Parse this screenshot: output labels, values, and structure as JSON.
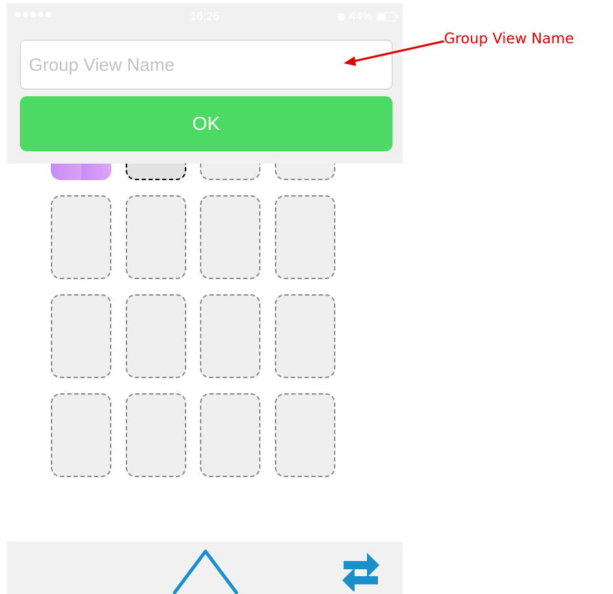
{
  "status_bar": {
    "time": "16:26",
    "battery": "44%",
    "signal_icon": "signal-dots-icon",
    "alarm_icon": "alarm-icon",
    "battery_icon": "battery-icon"
  },
  "dialog": {
    "name_input": {
      "value": "",
      "placeholder": "Group View Name"
    },
    "ok_label": "OK"
  },
  "annotation": {
    "label": "Group View Name",
    "color": "#e00000"
  },
  "grid": {
    "rows": 5,
    "columns": 4,
    "filled_slot_color": "#d49cf6"
  },
  "toolbar": {
    "up_icon": "triangle-up-icon",
    "swap_icon": "swap-arrows-icon"
  },
  "colors": {
    "ok_button": "#4cd964",
    "toolbar_icon": "#1a8fc8"
  }
}
